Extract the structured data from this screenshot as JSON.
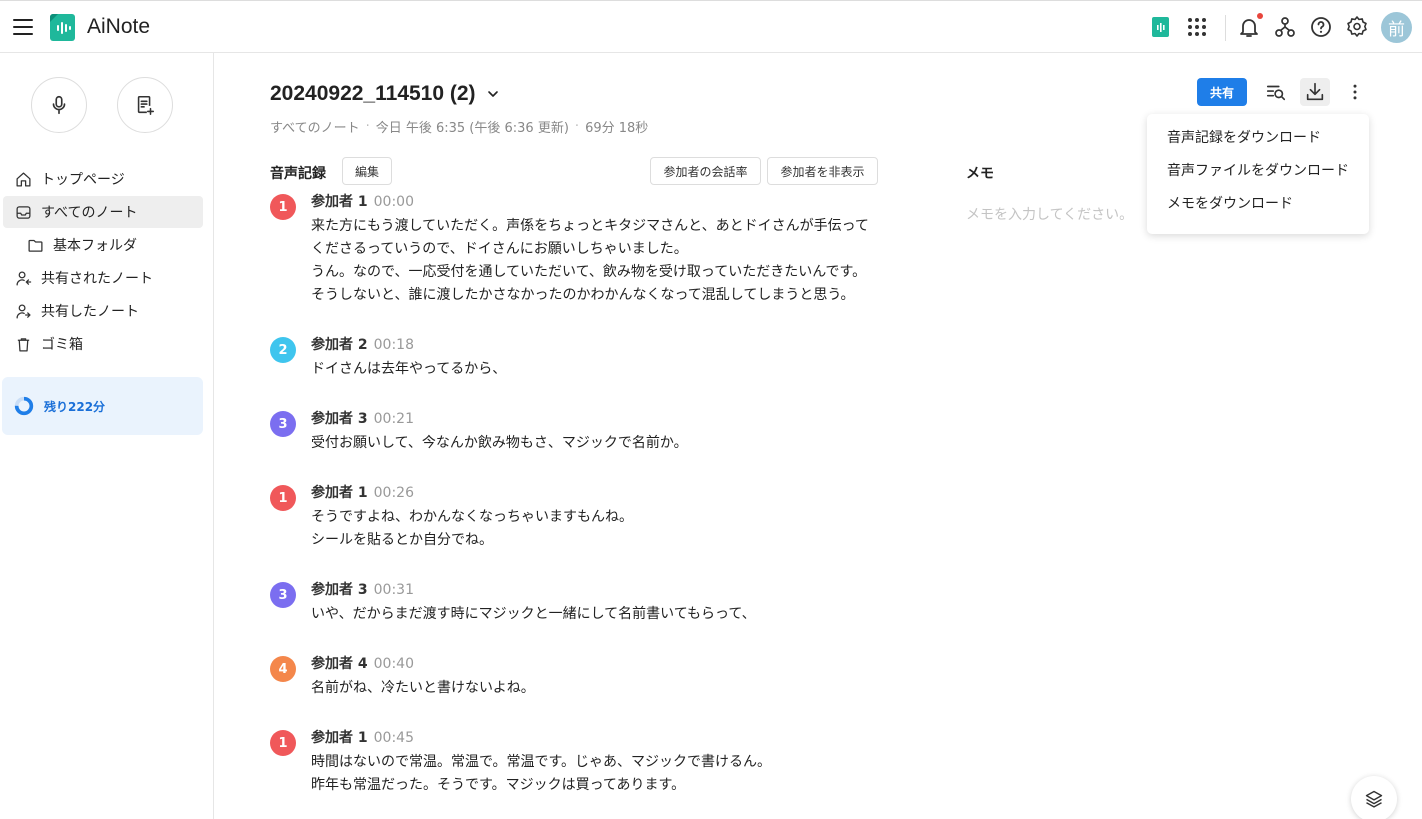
{
  "app": {
    "title": "AiNote",
    "avatar_text": "前"
  },
  "colors": {
    "accent": "#1f7ee8",
    "speaker1": "#f0585a",
    "speaker2": "#3fc5ee",
    "speaker3": "#7b6ef0",
    "speaker4": "#f4874b"
  },
  "topbar": {
    "icons": [
      "menu-icon",
      "ainote-app-icon",
      "apps-grid-icon",
      "bell-icon",
      "org-chart-icon",
      "help-icon",
      "gear-icon"
    ]
  },
  "sidebar": {
    "items": [
      {
        "label": "トップページ",
        "icon": "home-icon"
      },
      {
        "label": "すべてのノート",
        "icon": "inbox-icon",
        "active": true
      },
      {
        "label": "基本フォルダ",
        "icon": "folder-icon"
      },
      {
        "label": "共有されたノート",
        "icon": "shared-in-icon"
      },
      {
        "label": "共有したノート",
        "icon": "shared-out-icon"
      },
      {
        "label": "ゴミ箱",
        "icon": "trash-icon"
      }
    ],
    "remaining": "残り222分",
    "remaining_fraction": 0.75
  },
  "note": {
    "title": "20240922_114510 (2)",
    "breadcrumb": "すべてのノート",
    "updated": "今日 午後 6:35 (午後 6:36 更新)",
    "duration": "69分 18秒",
    "share_label": "共有"
  },
  "transcript": {
    "label": "音声記録",
    "edit_label": "編集",
    "talk_ratio_label": "参加者の会話率",
    "hide_label": "参加者を非表示",
    "entries": [
      {
        "num": "1",
        "speaker": "参加者 1",
        "time": "00:00",
        "color": "#f0585a",
        "lines": [
          "来た方にもう渡していただく。声係をちょっとキタジマさんと、あとドイさんが手伝って",
          "くださるっていうので、ドイさんにお願いしちゃいました。",
          "うん。なので、一応受付を通していただいて、飲み物を受け取っていただきたいんです。",
          "そうしないと、誰に渡したかさなかったのかわかんなくなって混乱してしまうと思う。"
        ]
      },
      {
        "num": "2",
        "speaker": "参加者 2",
        "time": "00:18",
        "color": "#3fc5ee",
        "lines": [
          "ドイさんは去年やってるから、"
        ]
      },
      {
        "num": "3",
        "speaker": "参加者 3",
        "time": "00:21",
        "color": "#7b6ef0",
        "lines": [
          "受付お願いして、今なんか飲み物もさ、マジックで名前か。"
        ]
      },
      {
        "num": "1",
        "speaker": "参加者 1",
        "time": "00:26",
        "color": "#f0585a",
        "lines": [
          "そうですよね、わかんなくなっちゃいますもんね。",
          "シールを貼るとか自分でね。"
        ]
      },
      {
        "num": "3",
        "speaker": "参加者 3",
        "time": "00:31",
        "color": "#7b6ef0",
        "lines": [
          "いや、だからまだ渡す時にマジックと一緒にして名前書いてもらって、"
        ]
      },
      {
        "num": "4",
        "speaker": "参加者 4",
        "time": "00:40",
        "color": "#f4874b",
        "lines": [
          "名前がね、冷たいと書けないよね。"
        ]
      },
      {
        "num": "1",
        "speaker": "参加者 1",
        "time": "00:45",
        "color": "#f0585a",
        "lines": [
          "時間はないので常温。常温で。常温です。じゃあ、マジックで書けるん。",
          "昨年も常温だった。そうです。マジックは買ってあります。"
        ]
      }
    ]
  },
  "memo": {
    "label": "メモ",
    "placeholder": "メモを入力してください。"
  },
  "download_menu": {
    "items": [
      "音声記録をダウンロード",
      "音声ファイルをダウンロード",
      "メモをダウンロード"
    ]
  }
}
